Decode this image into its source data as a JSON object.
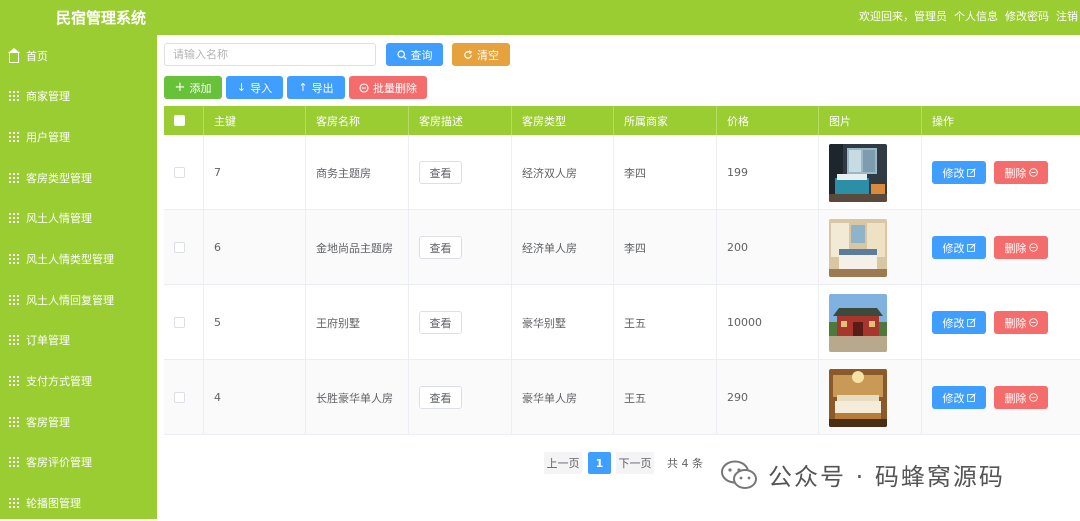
{
  "header": {
    "app_title": "民宿管理系统",
    "welcome": "欢迎回来，管理员",
    "profile": "个人信息",
    "change_password": "修改密码",
    "logout": "注销"
  },
  "sidebar": {
    "items": [
      {
        "label": "首页",
        "icon": "home-icon"
      },
      {
        "label": "商家管理",
        "icon": "grid-icon"
      },
      {
        "label": "用户管理",
        "icon": "grid-icon"
      },
      {
        "label": "客房类型管理",
        "icon": "grid-icon"
      },
      {
        "label": "风土人情管理",
        "icon": "grid-icon"
      },
      {
        "label": "风土人情类型管理",
        "icon": "grid-icon"
      },
      {
        "label": "风土人情回复管理",
        "icon": "grid-icon"
      },
      {
        "label": "订单管理",
        "icon": "grid-icon"
      },
      {
        "label": "支付方式管理",
        "icon": "grid-icon"
      },
      {
        "label": "客房管理",
        "icon": "grid-icon"
      },
      {
        "label": "客房评价管理",
        "icon": "grid-icon"
      },
      {
        "label": "轮播图管理",
        "icon": "grid-icon"
      }
    ]
  },
  "search": {
    "placeholder": "请输入名称",
    "query_label": "查询",
    "reset_label": "清空"
  },
  "toolbar": {
    "add_label": "添加",
    "import_label": "导入",
    "export_label": "导出",
    "batch_delete_label": "批量删除"
  },
  "table": {
    "columns": [
      "主键",
      "客房名称",
      "客房描述",
      "客房类型",
      "所属商家",
      "价格",
      "图片",
      "操作"
    ],
    "rows": [
      {
        "id": "7",
        "name": "商务主题房",
        "desc_btn": "查看",
        "type": "经济双人房",
        "merchant": "李四",
        "price": "199",
        "image": "room-photo-icon",
        "edit": "修改",
        "delete": "删除"
      },
      {
        "id": "6",
        "name": "金地尚品主题房",
        "desc_btn": "查看",
        "type": "经济单人房",
        "merchant": "李四",
        "price": "200",
        "image": "room-photo-icon",
        "edit": "修改",
        "delete": "删除"
      },
      {
        "id": "5",
        "name": "王府别墅",
        "desc_btn": "查看",
        "type": "豪华别墅",
        "merchant": "王五",
        "price": "10000",
        "image": "villa-photo-icon",
        "edit": "修改",
        "delete": "删除"
      },
      {
        "id": "4",
        "name": "长胜豪华单人房",
        "desc_btn": "查看",
        "type": "豪华单人房",
        "merchant": "王五",
        "price": "290",
        "image": "room-photo-icon",
        "edit": "修改",
        "delete": "删除"
      }
    ]
  },
  "pagination": {
    "prev": "上一页",
    "current": "1",
    "next": "下一页",
    "total": "共 4 条"
  },
  "watermark": {
    "text": "公众号 · 码蜂窝源码"
  },
  "colors": {
    "theme": "#9acd32",
    "primary": "#409eff",
    "warning": "#e6a23c",
    "success": "#67c23a",
    "danger": "#f56c6c"
  }
}
